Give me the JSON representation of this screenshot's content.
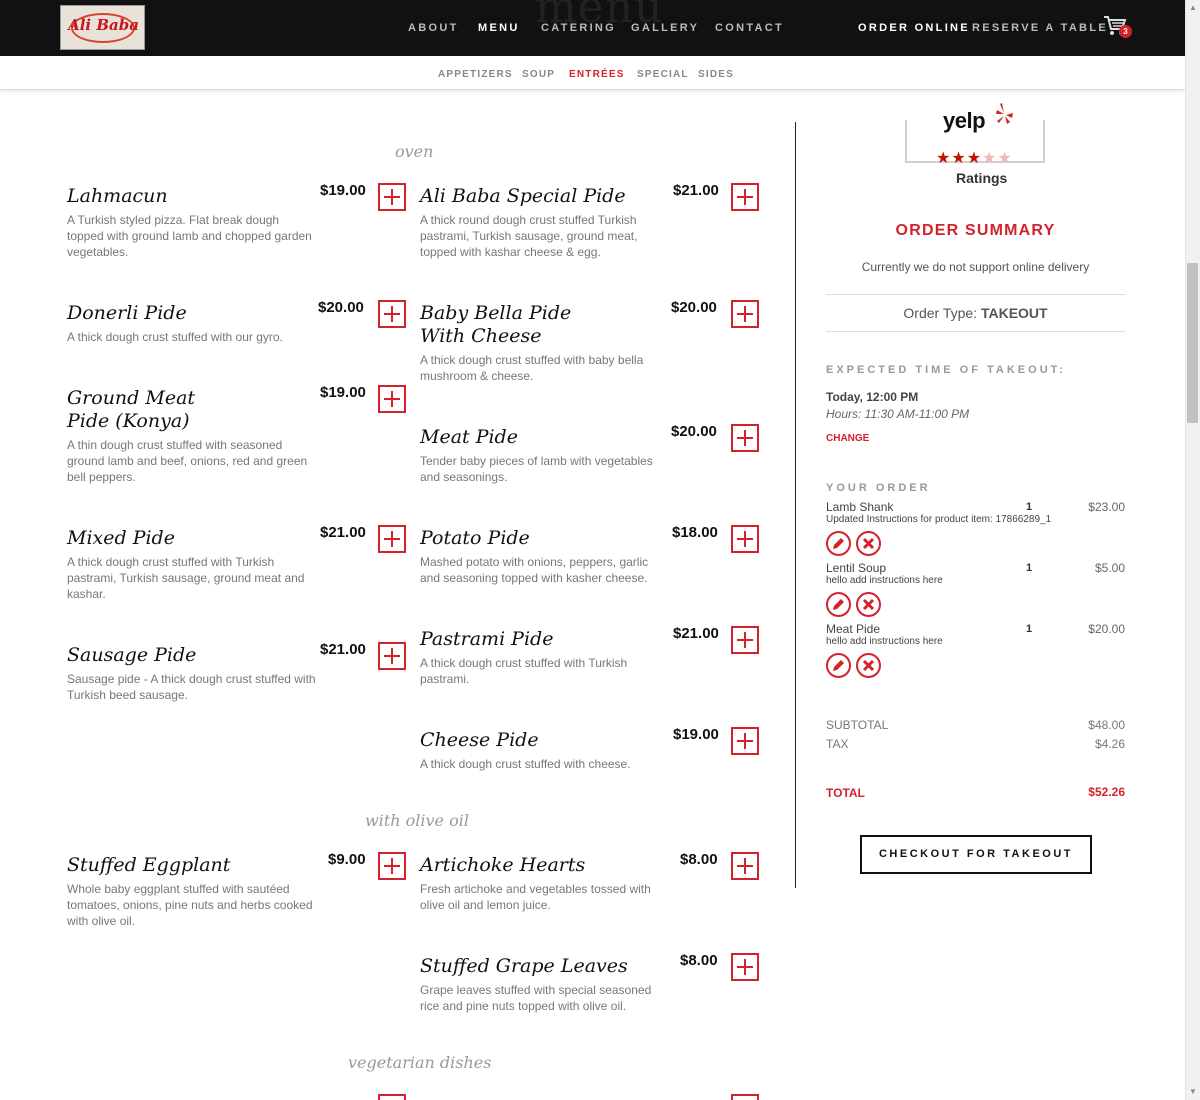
{
  "nav": {
    "logo_text": "Ali Baba",
    "page_title": "menu",
    "links": [
      "ABOUT",
      "MENU",
      "CATERING",
      "GALLERY",
      "CONTACT"
    ],
    "order_online": "ORDER ONLINE",
    "reserve": "RESERVE A TABLE",
    "cart_count": "3"
  },
  "subnav": [
    "APPETIZERS",
    "SOUP",
    "ENTRÉES",
    "SPECIAL",
    "SIDES"
  ],
  "sections": {
    "oven": "oven",
    "olive_oil": "with olive oil",
    "vegetarian": "vegetarian dishes"
  },
  "items": {
    "lahmacun": {
      "name": "Lahmacun",
      "price": "$19.00",
      "desc": "A Turkish styled pizza. Flat break dough topped with ground lamb and chopped garden vegetables."
    },
    "special_pide": {
      "name": "Ali Baba Special Pide",
      "price": "$21.00",
      "desc": "A thick round dough crust stuffed Turkish pastrami, Turkish sausage, ground meat, topped with kashar cheese & egg."
    },
    "donerli": {
      "name": "Donerli Pide",
      "price": "$20.00",
      "desc": "A thick dough crust stuffed with our gyro."
    },
    "baby_bella": {
      "name": "Baby Bella Pide With Cheese",
      "price": "$20.00",
      "desc": "A thick dough crust stuffed with baby bella mushroom & cheese."
    },
    "ground_meat": {
      "name": "Ground Meat Pide (Konya)",
      "price": "$19.00",
      "desc": "A thin dough crust stuffed with seasoned ground lamb and beef, onions, red and green bell peppers."
    },
    "meat_pide": {
      "name": "Meat Pide",
      "price": "$20.00",
      "desc": "Tender baby pieces of lamb with vegetables and seasonings."
    },
    "mixed_pide": {
      "name": "Mixed Pide",
      "price": "$21.00",
      "desc": "A thick dough crust stuffed with Turkish pastrami, Turkish sausage, ground meat and kashar."
    },
    "potato_pide": {
      "name": "Potato Pide",
      "price": "$18.00",
      "desc": "Mashed potato with onions, peppers, garlic and seasoning topped with kasher cheese."
    },
    "sausage_pide": {
      "name": "Sausage Pide",
      "price": "$21.00",
      "desc": "Sausage pide - A thick dough crust stuffed with Turkish beed sausage."
    },
    "pastrami_pide": {
      "name": "Pastrami Pide",
      "price": "$21.00",
      "desc": "A thick dough crust stuffed with Turkish pastrami."
    },
    "cheese_pide": {
      "name": "Cheese Pide",
      "price": "$19.00",
      "desc": "A thick dough crust stuffed with cheese."
    },
    "eggplant": {
      "name": "Stuffed Eggplant",
      "price": "$9.00",
      "desc": "Whole baby eggplant stuffed with sautéed tomatoes, onions, pine nuts and herbs cooked with olive oil."
    },
    "artichoke": {
      "name": "Artichoke Hearts",
      "price": "$8.00",
      "desc": "Fresh artichoke and vegetables tossed with olive oil and lemon juice."
    },
    "grape_leaves": {
      "name": "Stuffed Grape Leaves",
      "price": "$8.00",
      "desc": "Grape leaves stuffed with special seasoned rice and pine nuts topped with olive oil."
    }
  },
  "sidebar": {
    "yelp": "yelp",
    "ratings": "Ratings",
    "rating_value": 3,
    "order_summary": "ORDER SUMMARY",
    "delivery_note": "Currently we do not support online delivery",
    "order_type_label": "Order Type:",
    "order_type": "TAKEOUT",
    "expected_label": "EXPECTED TIME OF TAKEOUT:",
    "time": "Today, 12:00 PM",
    "hours": "Hours: 11:30 AM-11:00 PM",
    "change": "CHANGE",
    "your_order": "YOUR ORDER",
    "order_items": [
      {
        "name": "Lamb Shank",
        "note": "Updated Instructions for product item: 17866289_1",
        "qty": "1",
        "price": "$23.00"
      },
      {
        "name": "Lentil Soup",
        "note": "hello add instructions here",
        "qty": "1",
        "price": "$5.00"
      },
      {
        "name": "Meat Pide",
        "note": "hello add instructions here",
        "qty": "1",
        "price": "$20.00"
      }
    ],
    "subtotal_label": "SUBTOTAL",
    "subtotal": "$48.00",
    "tax_label": "TAX",
    "tax": "$4.26",
    "total_label": "TOTAL",
    "total": "$52.26",
    "checkout": "CHECKOUT FOR TAKEOUT"
  },
  "colors": {
    "accent": "#d3222a",
    "topbar": "#111111"
  }
}
